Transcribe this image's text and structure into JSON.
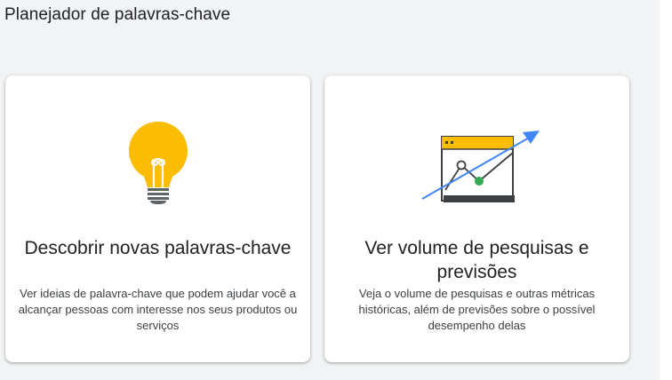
{
  "page": {
    "title": "Planejador de palavras-chave"
  },
  "cards": [
    {
      "icon": "lightbulb-icon",
      "title": "Descobrir novas palavras-chave",
      "description": "Ver ideias de palavra-chave que podem ajudar você a alcançar pessoas com interesse nos seus produtos ou serviços"
    },
    {
      "icon": "trend-chart-icon",
      "title": "Ver volume de pesquisas e previsões",
      "description": "Veja o volume de pesquisas e outras métricas históricas, além de previsões sobre o possível desempenho delas"
    }
  ],
  "colors": {
    "background": "#f1f3f4",
    "card": "#ffffff",
    "yellow": "#fbbc04",
    "blue": "#4285f4",
    "green": "#34a853",
    "dark": "#3c4043"
  }
}
